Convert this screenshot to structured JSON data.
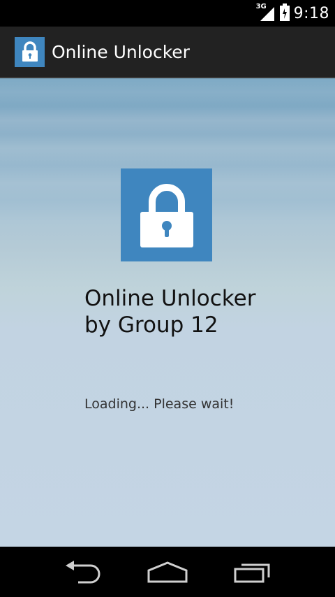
{
  "status_bar": {
    "network_type": "3G",
    "time": "9:18",
    "icons": [
      "signal-icon",
      "battery-icon"
    ]
  },
  "action_bar": {
    "icon": "lock-icon",
    "title": "Online Unlocker"
  },
  "main": {
    "icon": "lock-icon",
    "title_line1": "Online Unlocker",
    "title_line2": "by Group 12",
    "loading_message": "Loading... Please wait!"
  },
  "nav_bar": {
    "buttons": [
      "back-icon",
      "home-icon",
      "recent-apps-icon"
    ]
  },
  "colors": {
    "accent": "#3f86bf",
    "action_bar_bg": "#222222",
    "content_bg": "#c4d5e4"
  }
}
